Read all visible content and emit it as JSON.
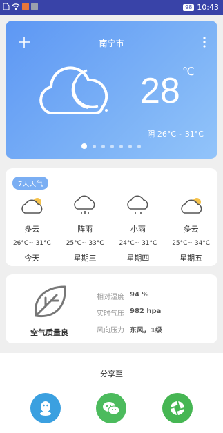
{
  "status_bar": {
    "time": "10:43",
    "battery": "98"
  },
  "header": {
    "city": "南宁市"
  },
  "current": {
    "temperature": "28",
    "unit": "℃",
    "condition_range": "阴 26°C~ 31°C"
  },
  "forecast": {
    "badge": "7天天气",
    "days": [
      {
        "condition": "多云",
        "range": "26°C~ 31°C",
        "day": "今天",
        "icon": "partly-cloudy-icon"
      },
      {
        "condition": "阵雨",
        "range": "25°C~ 33°C",
        "day": "星期三",
        "icon": "shower-icon"
      },
      {
        "condition": "小雨",
        "range": "24°C~ 31°C",
        "day": "星期四",
        "icon": "light-rain-icon"
      },
      {
        "condition": "多云",
        "range": "25°C~ 34°C",
        "day": "星期五",
        "icon": "partly-cloudy-icon"
      }
    ]
  },
  "air": {
    "label": "空气质量良",
    "rows": [
      {
        "key": "相对湿度",
        "value": "94 %"
      },
      {
        "key": "实时气压",
        "value": "982 hpa"
      },
      {
        "key": "风向压力",
        "value": "东风，1级"
      }
    ]
  },
  "share": {
    "title": "分享至",
    "targets": [
      {
        "name": "qq",
        "color": "#3ba0e0"
      },
      {
        "name": "wechat",
        "color": "#4cbb5d"
      },
      {
        "name": "moments",
        "color": "#46b653"
      }
    ]
  }
}
